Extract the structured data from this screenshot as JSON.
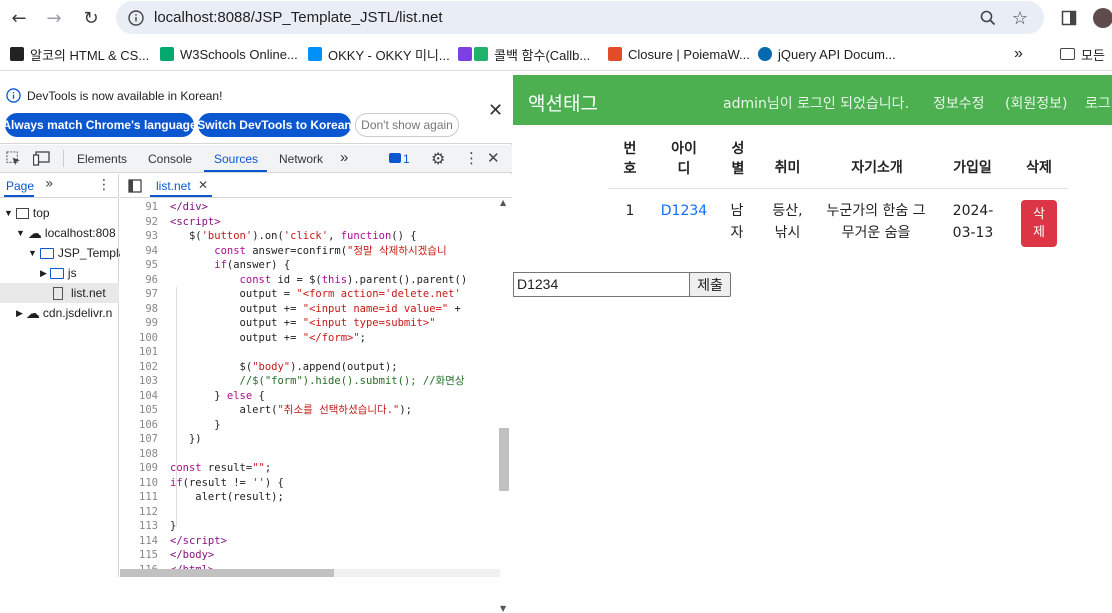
{
  "browser": {
    "url": "localhost:8088/JSP_Template_JSTL/list.net",
    "bookmarks": [
      {
        "label": "알코의 HTML & CS...",
        "color": "#222"
      },
      {
        "label": "W3Schools Online...",
        "color": "#04aa6d"
      },
      {
        "label": "OKKY - OKKY 미니...",
        "color": "#0090f9"
      },
      {
        "label": "콜백 함수(Callb...",
        "color": "#7b3fe4"
      },
      {
        "label": "Closure | PoiemaW...",
        "color": "#e34c26"
      },
      {
        "label": "jQuery API Docum...",
        "color": "#0769ad"
      }
    ],
    "bookmarks_more": "»",
    "all_bookmarks": "모든"
  },
  "devtools": {
    "info_message": "DevTools is now available in Korean!",
    "btn_match": "Always match Chrome's language",
    "btn_switch": "Switch DevTools to Korean",
    "btn_dont_show": "Don't show again",
    "tabs": [
      "Elements",
      "Console",
      "Sources",
      "Network"
    ],
    "issues_count": "1",
    "page_tab": "Page",
    "file_tab": "list.net",
    "tree": {
      "top": "top",
      "host": "localhost:808",
      "project": "JSP_Templa",
      "js": "js",
      "file": "list.net",
      "cdn": "cdn.jsdelivr.n"
    },
    "line_numbers": [
      "91",
      "92",
      "93",
      "94",
      "95",
      "96",
      "97",
      "98",
      "99",
      "100",
      "101",
      "102",
      "103",
      "104",
      "105",
      "106",
      "107",
      "108",
      "109",
      "110",
      "111",
      "112",
      "113",
      "114",
      "115",
      "116"
    ]
  },
  "page": {
    "brand": "액션태그",
    "login_msg": "admin님이 로그인 되었습니다.",
    "edit_info": "정보수정",
    "member_info": "(회원정보)",
    "logout": "로그",
    "table": {
      "headers": [
        "번호",
        "아이디",
        "성별",
        "취미",
        "자기소개",
        "가입일",
        "삭제"
      ],
      "rows": [
        {
          "no": "1",
          "id": "D1234",
          "gender": "남자",
          "hobby": "등산, 낚시",
          "intro": "누군가의 한숨 그 무거운 숨을",
          "joined": "2024-03-13",
          "delete_label": "삭제"
        }
      ]
    },
    "id_input_value": "D1234",
    "submit_label": "제출"
  },
  "colors": {
    "header_green": "#4caf50",
    "delete_red": "#dc3545",
    "link_blue": "#0b57d0"
  }
}
